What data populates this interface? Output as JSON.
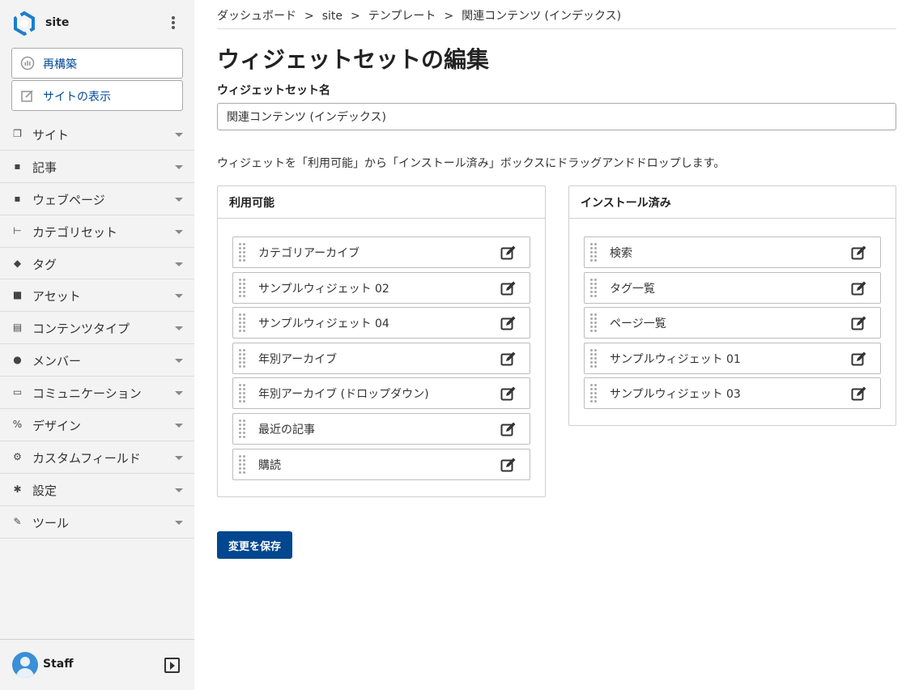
{
  "sidebar": {
    "site_name": "site",
    "rebuild_label": "再構築",
    "view_site_label": "サイトの表示",
    "menu": [
      {
        "label": "サイト",
        "icon": "site-icon"
      },
      {
        "label": "記事",
        "icon": "entry-icon"
      },
      {
        "label": "ウェブページ",
        "icon": "page-icon"
      },
      {
        "label": "カテゴリセット",
        "icon": "category-set-icon"
      },
      {
        "label": "タグ",
        "icon": "tag-icon"
      },
      {
        "label": "アセット",
        "icon": "asset-icon"
      },
      {
        "label": "コンテンツタイプ",
        "icon": "content-type-icon"
      },
      {
        "label": "メンバー",
        "icon": "member-icon"
      },
      {
        "label": "コミュニケーション",
        "icon": "comment-icon"
      },
      {
        "label": "デザイン",
        "icon": "design-icon"
      },
      {
        "label": "カスタムフィールド",
        "icon": "custom-field-icon"
      },
      {
        "label": "設定",
        "icon": "gear-icon"
      },
      {
        "label": "ツール",
        "icon": "wrench-icon"
      }
    ],
    "user_name": "Staff"
  },
  "breadcrumb": [
    "ダッシュボード",
    "site",
    "テンプレート",
    "関連コンテンツ (インデックス)"
  ],
  "breadcrumb_separator": ">",
  "page_title": "ウィジェットセットの編集",
  "name_field": {
    "label": "ウィジェットセット名",
    "value": "関連コンテンツ (インデックス)"
  },
  "instruction": "ウィジェットを「利用可能」から「インストール済み」ボックスにドラッグアンドドロップします。",
  "available": {
    "title": "利用可能",
    "widgets": [
      "カテゴリアーカイブ",
      "サンプルウィジェット 02",
      "サンプルウィジェット 04",
      "年別アーカイブ",
      "年別アーカイブ (ドロップダウン)",
      "最近の記事",
      "購読"
    ]
  },
  "installed": {
    "title": "インストール済み",
    "widgets": [
      "検索",
      "タグ一覧",
      "ページ一覧",
      "サンプルウィジェット 01",
      "サンプルウィジェット 03"
    ]
  },
  "save_label": "変更を保存",
  "colors": {
    "accent": "#00478f",
    "link": "#004a99",
    "sidebar_bg": "#f3f3f3"
  }
}
